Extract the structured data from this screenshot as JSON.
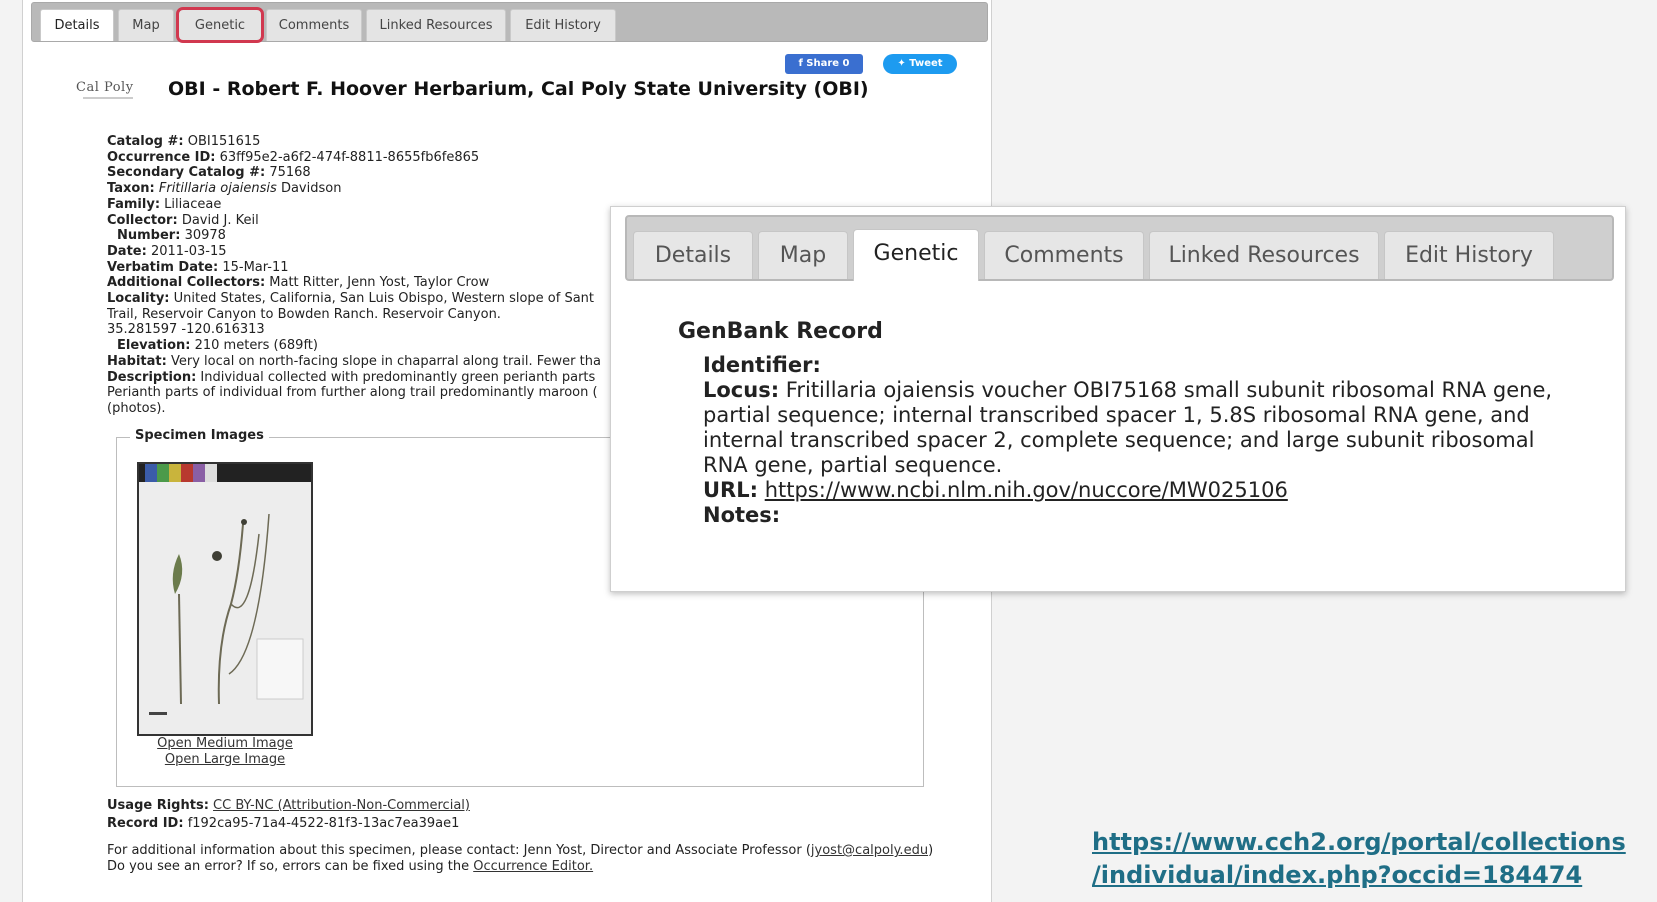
{
  "tabs": [
    "Details",
    "Map",
    "Genetic",
    "Comments",
    "Linked Resources",
    "Edit History"
  ],
  "share": {
    "facebook": "Share 0",
    "twitter": "Tweet"
  },
  "logo_text": "Cal Poly",
  "collection_title": "OBI - Robert F. Hoover Herbarium, Cal Poly State University (OBI)",
  "record": {
    "catalog_label": "Catalog #:",
    "catalog": "OBI151615",
    "occurrence_label": "Occurrence ID:",
    "occurrence": "63ff95e2-a6f2-474f-8811-8655fb6fe865",
    "secondary_label": "Secondary Catalog #:",
    "secondary": "75168",
    "taxon_label": "Taxon:",
    "taxon": "Fritillaria ojaiensis",
    "taxon_author": "Davidson",
    "family_label": "Family:",
    "family": "Liliaceae",
    "collector_label": "Collector:",
    "collector": "David J. Keil",
    "number_label": "Number:",
    "number": "30978",
    "date_label": "Date:",
    "date": "2011-03-15",
    "verbatim_label": "Verbatim Date:",
    "verbatim": "15-Mar-11",
    "addl_label": "Additional Collectors:",
    "addl": "Matt Ritter, Jenn Yost, Taylor Crow",
    "locality_label": "Locality:",
    "locality": "United States, California, San Luis Obispo, Western slope of Sant",
    "locality2": "Trail, Reservoir Canyon to Bowden Ranch. Reservoir Canyon.",
    "coords": "35.281597 -120.616313",
    "elevation_label": "Elevation:",
    "elevation": "210 meters (689ft)",
    "habitat_label": "Habitat:",
    "habitat": "Very local on north-facing slope in chaparral along trail. Fewer tha",
    "description_label": "Description:",
    "description": "Individual collected with predominantly green perianth parts",
    "description2": "Perianth parts of individual from further along trail predominantly maroon (",
    "description3": "(photos)."
  },
  "specimen": {
    "legend": "Specimen Images",
    "open_medium": "Open Medium Image",
    "open_large": "Open Large Image"
  },
  "footer": {
    "usage_label": "Usage Rights:",
    "usage": "CC BY-NC (Attribution-Non-Commercial)",
    "record_id_label": "Record ID:",
    "record_id": "f192ca95-71a4-4522-81f3-13ac7ea39ae1",
    "contact_prefix": "For additional information about this specimen, please contact: Jenn Yost, Director and Associate Professor (",
    "contact_email": "jyost@calpoly.edu",
    "contact_suffix": ")",
    "error_prefix": "Do you see an error? If so, errors can be fixed using the ",
    "error_link": "Occurrence Editor."
  },
  "genbank": {
    "title": "GenBank Record",
    "identifier_label": "Identifier:",
    "locus_label": "Locus:",
    "locus": "Fritillaria ojaiensis voucher OBI75168 small subunit ribosomal RNA gene, partial sequence; internal transcribed spacer 1, 5.8S ribosomal RNA gene, and internal transcribed spacer 2, complete sequence; and large subunit ribosomal RNA gene, partial sequence.",
    "url_label": "URL:",
    "url": "https://www.ncbi.nlm.nih.gov/nuccore/MW025106",
    "notes_label": "Notes:"
  },
  "big_url": {
    "line1": "https://www.cch2.org/portal/collections",
    "line2": "/individual/index.php?occid=184474"
  }
}
